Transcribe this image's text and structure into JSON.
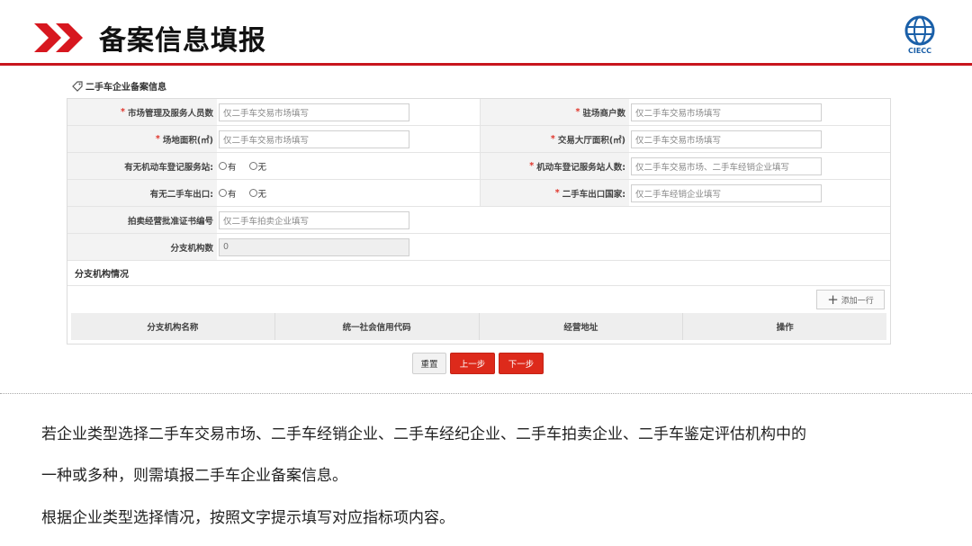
{
  "slide": {
    "title": "备案信息填报",
    "logo_text": "CIECC",
    "colors": {
      "accent": "#c8161d",
      "button_red": "#dd2a1b",
      "logo_blue": "#1a5fa8"
    }
  },
  "form": {
    "section_title": "二手车企业备案信息",
    "rows": [
      {
        "left_label": "市场管理及服务人员数",
        "left_required": "*",
        "left_placeholder": "仅二手车交易市场填写",
        "right_label": "驻场商户数",
        "right_required": "*",
        "right_placeholder": "仅二手车交易市场填写"
      },
      {
        "left_label": "场地面积(㎡)",
        "left_required": "*",
        "left_placeholder": "仅二手车交易市场填写",
        "right_label": "交易大厅面积(㎡)",
        "right_required": "*",
        "right_placeholder": "仅二手车交易市场填写"
      },
      {
        "left_label": "有无机动车登记服务站:",
        "left_opt_yes": "有",
        "left_opt_no": "无",
        "right_label": "机动车登记服务站人数:",
        "right_required": "*",
        "right_placeholder": "仅二手车交易市场、二手车经销企业填写"
      },
      {
        "left_label": "有无二手车出口:",
        "left_opt_yes": "有",
        "left_opt_no": "无",
        "right_label": "二手车出口国家:",
        "right_required": "*",
        "right_placeholder": "仅二手车经销企业填写"
      },
      {
        "left_label": "拍卖经营批准证书编号",
        "left_placeholder": "仅二手车拍卖企业填写"
      },
      {
        "left_label": "分支机构数",
        "left_value": "0"
      }
    ],
    "branch_section_title": "分支机构情况",
    "add_row_label": "添加一行",
    "table_headers": [
      "分支机构名称",
      "统一社会信用代码",
      "经营地址",
      "操作"
    ],
    "buttons": {
      "reset": "重置",
      "prev": "上一步",
      "next": "下一步"
    }
  },
  "description": [
    "若企业类型选择二手车交易市场、二手车经销企业、二手车经纪企业、二手车拍卖企业、二手车鉴定评估机构中的",
    "一种或多种，则需填报二手车企业备案信息。",
    "根据企业类型选择情况，按照文字提示填写对应指标项内容。"
  ]
}
